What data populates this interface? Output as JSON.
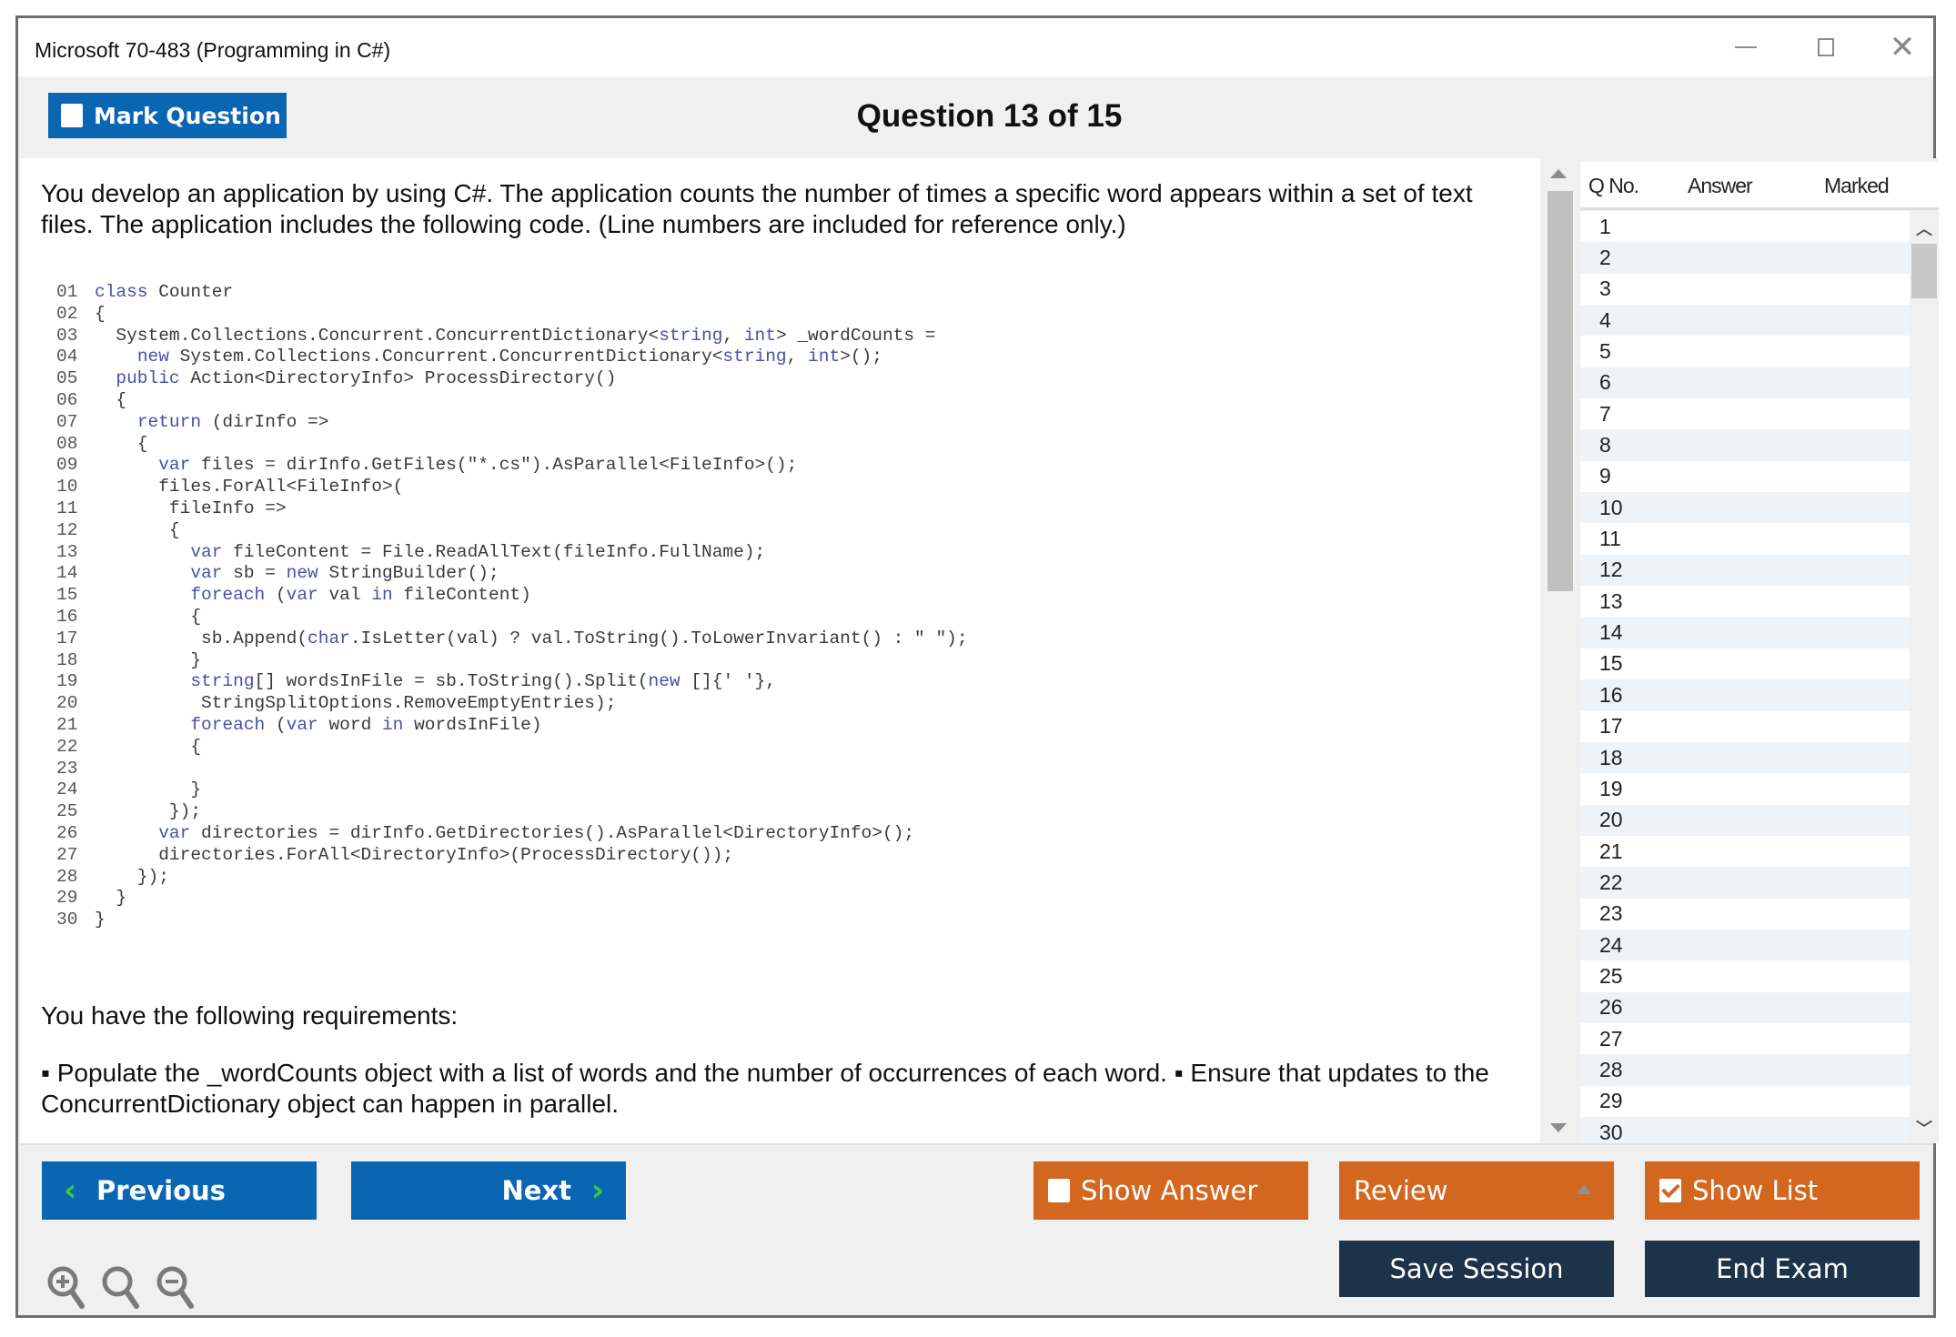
{
  "window": {
    "title": "Microsoft 70-483 (Programming in C#)",
    "controls": [
      "minimize",
      "maximize",
      "close"
    ]
  },
  "header": {
    "mark_question_label": "Mark Question",
    "mark_question_checked": false,
    "question_title": "Question 13 of 15"
  },
  "question": {
    "intro": "You develop an application by using C#. The application counts the number of times a specific word appears within a set of text files. The application includes the following code. (Line numbers are included for reference only.)",
    "code_lines": [
      {
        "n": "01",
        "indent": 0,
        "text": "class Counter"
      },
      {
        "n": "02",
        "indent": 0,
        "text": "{"
      },
      {
        "n": "03",
        "indent": 1,
        "text": "System.Collections.Concurrent.ConcurrentDictionary<string, int> _wordCounts ="
      },
      {
        "n": "04",
        "indent": 2,
        "text": "new System.Collections.Concurrent.ConcurrentDictionary<string, int>();"
      },
      {
        "n": "05",
        "indent": 1,
        "text": "public Action<DirectoryInfo> ProcessDirectory()"
      },
      {
        "n": "06",
        "indent": 1,
        "text": "{"
      },
      {
        "n": "07",
        "indent": 2,
        "text": "return (dirInfo =>"
      },
      {
        "n": "08",
        "indent": 2,
        "text": "{"
      },
      {
        "n": "09",
        "indent": 3,
        "text": "var files = dirInfo.GetFiles(\"*.cs\").AsParallel<FileInfo>();"
      },
      {
        "n": "10",
        "indent": 3,
        "text": "files.ForAll<FileInfo>("
      },
      {
        "n": "11",
        "indent": 3,
        "text": " fileInfo =>"
      },
      {
        "n": "12",
        "indent": 3,
        "text": " {"
      },
      {
        "n": "13",
        "indent": 4,
        "text": " var fileContent = File.ReadAllText(fileInfo.FullName);"
      },
      {
        "n": "14",
        "indent": 4,
        "text": " var sb = new StringBuilder();"
      },
      {
        "n": "15",
        "indent": 4,
        "text": " foreach (var val in fileContent)"
      },
      {
        "n": "16",
        "indent": 4,
        "text": " {"
      },
      {
        "n": "17",
        "indent": 5,
        "text": "sb.Append(char.IsLetter(val) ? val.ToString().ToLowerInvariant() : \" \");"
      },
      {
        "n": "18",
        "indent": 4,
        "text": " }"
      },
      {
        "n": "19",
        "indent": 4,
        "text": " string[] wordsInFile = sb.ToString().Split(new []{' '},"
      },
      {
        "n": "20",
        "indent": 4,
        "text": "  StringSplitOptions.RemoveEmptyEntries);"
      },
      {
        "n": "21",
        "indent": 4,
        "text": " foreach (var word in wordsInFile)"
      },
      {
        "n": "22",
        "indent": 4,
        "text": " {"
      },
      {
        "n": "23",
        "indent": 0,
        "text": ""
      },
      {
        "n": "24",
        "indent": 4,
        "text": " }"
      },
      {
        "n": "25",
        "indent": 3,
        "text": " });"
      },
      {
        "n": "26",
        "indent": 3,
        "text": "var directories = dirInfo.GetDirectories().AsParallel<DirectoryInfo>();"
      },
      {
        "n": "27",
        "indent": 3,
        "text": "directories.ForAll<DirectoryInfo>(ProcessDirectory());"
      },
      {
        "n": "28",
        "indent": 2,
        "text": "});"
      },
      {
        "n": "29",
        "indent": 1,
        "text": "}"
      },
      {
        "n": "30",
        "indent": 0,
        "text": "}"
      }
    ],
    "code_keywords": [
      "class",
      "new",
      "public",
      "return",
      "var",
      "foreach",
      "in",
      "string",
      "int",
      "char"
    ],
    "requirements_heading": "You have the following requirements:",
    "requirements_text": "▪ Populate the _wordCounts object with a list of words and the number of occurrences of each word. ▪ Ensure that updates to the ConcurrentDictionary object can happen in parallel."
  },
  "question_list": {
    "columns": [
      "Q No.",
      "Answer",
      "Marked"
    ],
    "rows": [
      {
        "q": "1",
        "answer": "",
        "marked": ""
      },
      {
        "q": "2",
        "answer": "",
        "marked": ""
      },
      {
        "q": "3",
        "answer": "",
        "marked": ""
      },
      {
        "q": "4",
        "answer": "",
        "marked": ""
      },
      {
        "q": "5",
        "answer": "",
        "marked": ""
      },
      {
        "q": "6",
        "answer": "",
        "marked": ""
      },
      {
        "q": "7",
        "answer": "",
        "marked": ""
      },
      {
        "q": "8",
        "answer": "",
        "marked": ""
      },
      {
        "q": "9",
        "answer": "",
        "marked": ""
      },
      {
        "q": "10",
        "answer": "",
        "marked": ""
      },
      {
        "q": "11",
        "answer": "",
        "marked": ""
      },
      {
        "q": "12",
        "answer": "",
        "marked": ""
      },
      {
        "q": "13",
        "answer": "",
        "marked": ""
      },
      {
        "q": "14",
        "answer": "",
        "marked": ""
      },
      {
        "q": "15",
        "answer": "",
        "marked": ""
      },
      {
        "q": "16",
        "answer": "",
        "marked": ""
      },
      {
        "q": "17",
        "answer": "",
        "marked": ""
      },
      {
        "q": "18",
        "answer": "",
        "marked": ""
      },
      {
        "q": "19",
        "answer": "",
        "marked": ""
      },
      {
        "q": "20",
        "answer": "",
        "marked": ""
      },
      {
        "q": "21",
        "answer": "",
        "marked": ""
      },
      {
        "q": "22",
        "answer": "",
        "marked": ""
      },
      {
        "q": "23",
        "answer": "",
        "marked": ""
      },
      {
        "q": "24",
        "answer": "",
        "marked": ""
      },
      {
        "q": "25",
        "answer": "",
        "marked": ""
      },
      {
        "q": "26",
        "answer": "",
        "marked": ""
      },
      {
        "q": "27",
        "answer": "",
        "marked": ""
      },
      {
        "q": "28",
        "answer": "",
        "marked": ""
      },
      {
        "q": "29",
        "answer": "",
        "marked": ""
      },
      {
        "q": "30",
        "answer": "",
        "marked": ""
      }
    ]
  },
  "footer": {
    "previous_label": "Previous",
    "next_label": "Next",
    "show_answer_label": "Show Answer",
    "show_answer_checked": false,
    "review_label": "Review",
    "show_list_label": "Show List",
    "show_list_checked": true,
    "save_session_label": "Save Session",
    "end_exam_label": "End Exam",
    "zoom_icons": [
      "zoom-in-icon",
      "zoom-reset-icon",
      "zoom-out-icon"
    ]
  },
  "colors": {
    "primary_blue": "#0a66b3",
    "accent_orange": "#d3671f",
    "navy": "#1c3349",
    "arrow_green": "#3dcc3d",
    "code_keyword": "#4750a6"
  }
}
